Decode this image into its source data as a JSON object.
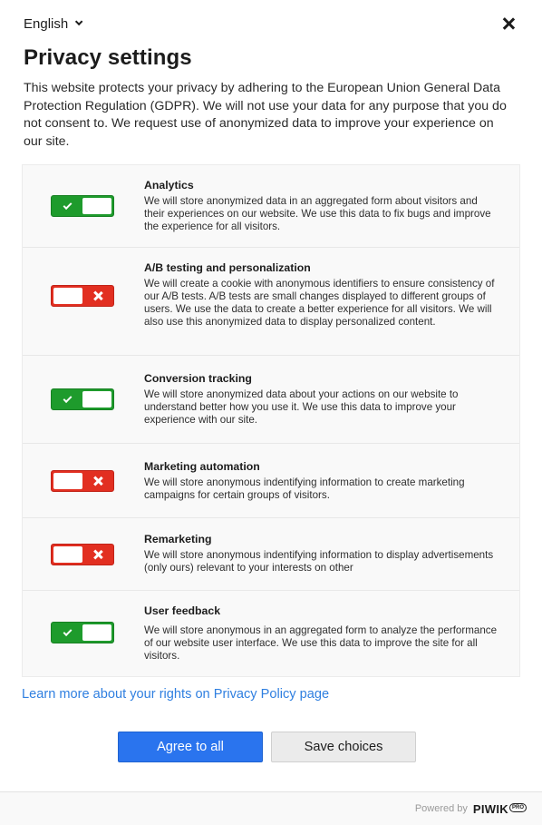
{
  "header": {
    "language": "English",
    "title": "Privacy settings",
    "intro": "This website protects your privacy by adhering to the European Union General Data Protection Regulation (GDPR). We will not use your data for any purpose that you do not consent to. We request use of anonymized data to improve your experience on our site."
  },
  "consents": [
    {
      "title": "Analytics",
      "description": "We will store anonymized data in an aggregated form about visitors and their experiences on our website. We use this data to fix bugs and improve the experience for all visitors.",
      "enabled": true
    },
    {
      "title": "A/B testing and personalization",
      "description": "We will create a cookie with anonymous identifiers to ensure consistency of our A/B tests. A/B tests are small changes displayed to different groups of users. We use the data to create a better experience for all visitors. We will also use this anonymized data to display personalized content.",
      "enabled": false
    },
    {
      "title": "Conversion tracking",
      "description": "We will store anonymized data about your actions on our website to understand better how you use it. We use this data to improve your experience with our site.",
      "enabled": true
    },
    {
      "title": "Marketing automation",
      "description": "We will store anonymous indentifying information to create marketing campaigns for certain groups of visitors.",
      "enabled": false
    },
    {
      "title": "Remarketing",
      "description": "We will store anonymous indentifying information to display advertisements (only ours) relevant to your interests on other",
      "enabled": false
    },
    {
      "title": "User feedback",
      "description": "We will store anonymous in an aggregated form to analyze the performance of our website user interface. We use this data to improve the site for all visitors.",
      "enabled": true
    }
  ],
  "links": {
    "privacy_policy": "Learn more about your rights on Privacy Policy page"
  },
  "buttons": {
    "agree_all": "Agree to all",
    "save_choices": "Save choices"
  },
  "footer": {
    "powered_by": "Powered by",
    "brand": "PIWIK",
    "brand_badge": "PRO"
  },
  "colors": {
    "toggle_on": "#1e9b2c",
    "toggle_off": "#e22f21",
    "primary_button": "#2a74ee",
    "link": "#2f7fe0"
  }
}
